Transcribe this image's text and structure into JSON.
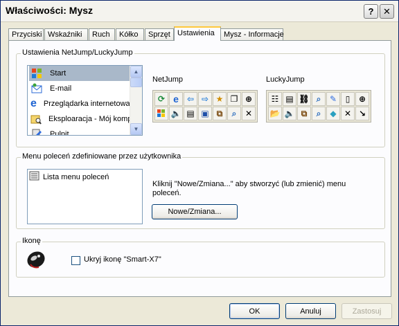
{
  "window": {
    "title": "Właściwości: Mysz"
  },
  "titlebar_buttons": {
    "help": "?",
    "close": "✕"
  },
  "tabs": [
    "Przyciski",
    "Wskaźniki",
    "Ruch",
    "Kółko",
    "Sprzęt",
    "Ustawienia",
    "Mysz - Informacje"
  ],
  "active_tab": "Ustawienia",
  "jump_group": {
    "label": "Ustawienia NetJump/LuckyJump",
    "list": [
      {
        "label": "Start",
        "icon": "windows-flag-icon",
        "selected": true
      },
      {
        "label": "E-mail",
        "icon": "email-icon",
        "selected": false
      },
      {
        "label": "Przeglądarka internetowa",
        "icon": "internet-explorer-icon",
        "selected": false
      },
      {
        "label": "Eksploaracja - Mój kompu",
        "icon": "explorer-icon",
        "selected": false
      },
      {
        "label": "Pulpit",
        "icon": "desktop-icon",
        "selected": false
      }
    ],
    "netjump_label": "NetJump",
    "luckyjump_label": "LuckyJump",
    "netjump_icons": [
      "refresh-icon",
      "ie-icon",
      "arrow-left-icon",
      "arrow-right-icon",
      "favorites-icon",
      "copy-icon",
      "crosshair-icon",
      "windows-flag-icon",
      "volume-icon",
      "document-icon",
      "window-icon",
      "window-switch-icon",
      "search-icon",
      "close-x-icon"
    ],
    "luckyjump_icons": [
      "toolbar-icon",
      "document-icon",
      "link-icon",
      "search-icon",
      "edit-icon",
      "scroll-bar-icon",
      "crosshair-icon",
      "folder-open-icon",
      "volume-icon",
      "window-icon",
      "search-icon",
      "eraser-icon",
      "close-x-icon",
      "resize-arrow-icon"
    ]
  },
  "menu_group": {
    "label": "Menu poleceń zdefiniowane przez użytkownika",
    "list_item": "Lista menu poleceń",
    "hint": "Kliknij \"Nowe/Zmiana...\" aby stworzyć (lub zmienić) menu poleceń.",
    "button": "Nowe/Zmiana..."
  },
  "icon_group": {
    "label": "Ikonę",
    "checkbox_label": "Ukryj ikonę \"Smart-X7\"",
    "checked": false
  },
  "footer": {
    "ok": "OK",
    "cancel": "Anuluj",
    "apply": "Zastosuj"
  }
}
